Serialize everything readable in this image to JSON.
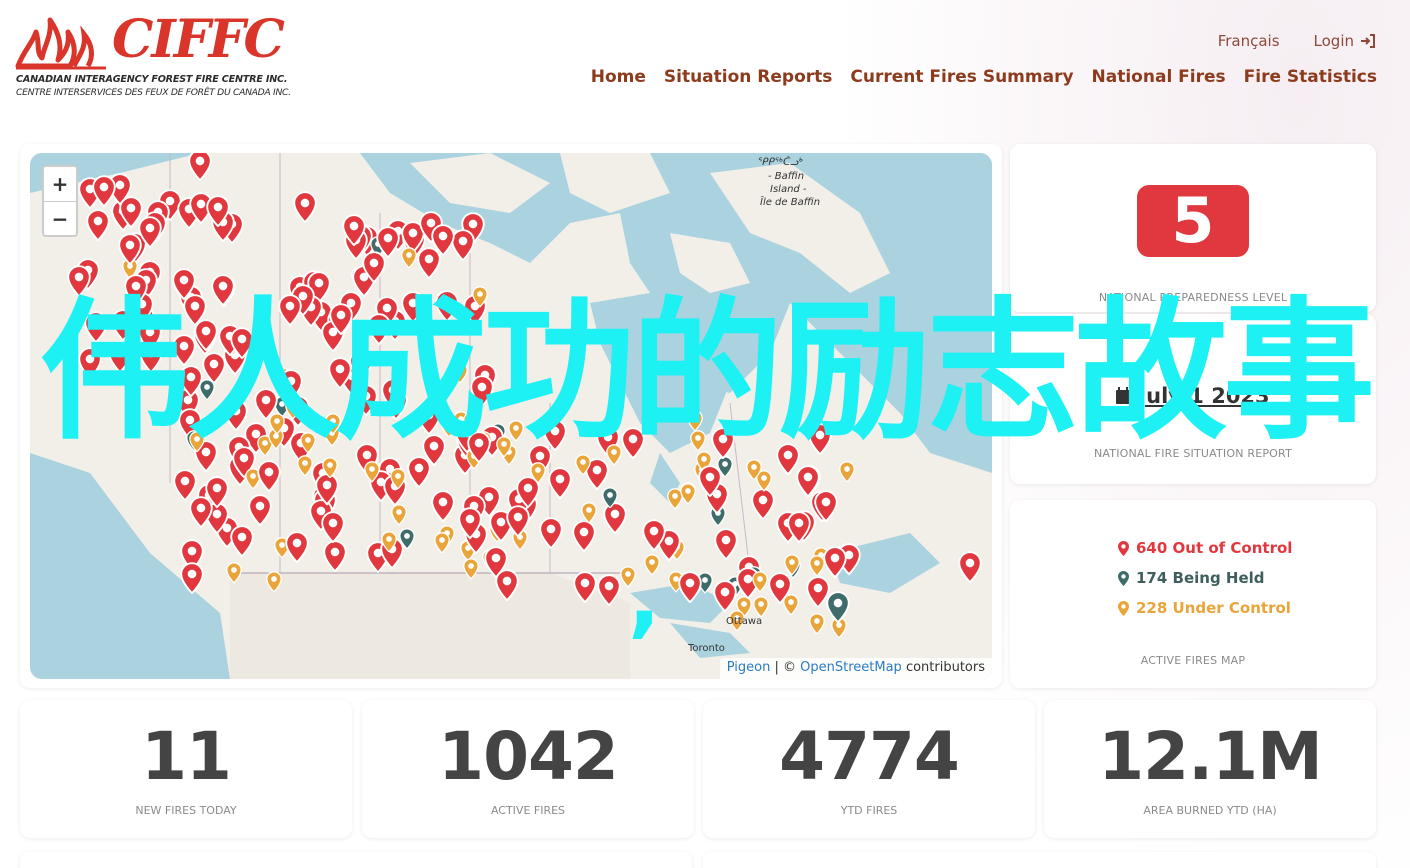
{
  "header": {
    "logo_word": "CIFFC",
    "logo_line_en": "CANADIAN INTERAGENCY FOREST FIRE CENTRE INC.",
    "logo_line_fr": "CENTRE INTERSERVICES DES FEUX DE FORÊT DU CANADA INC.",
    "lang_link": "Français",
    "login_link": "Login",
    "nav": [
      "Home",
      "Situation Reports",
      "Current Fires Summary",
      "National Fires",
      "Fire Statistics"
    ]
  },
  "map": {
    "zoom_in": "+",
    "zoom_out": "−",
    "attribution_pigeon": "Pigeon",
    "attribution_sep": " | © ",
    "attribution_osm": "OpenStreetMap",
    "attribution_tail": " contributors",
    "label_baffin_1": "ᕿᑭᖅᑖᓗᒃ",
    "label_baffin_2": "- Baffin",
    "label_baffin_3": "Island -",
    "label_baffin_4": "Île de Baffin",
    "label_ottawa": "Ottawa",
    "label_toronto": "Toronto",
    "colors": {
      "out_of_control": "#e0383e",
      "being_held": "#3f6b6a",
      "under_control": "#eaa53a"
    }
  },
  "preparedness": {
    "level": "5",
    "caption": "NATIONAL PREPAREDNESS LEVEL",
    "color": "#e0383e"
  },
  "report": {
    "date_visible": "July 1  2023",
    "caption": "NATIONAL FIRE SITUATION REPORT"
  },
  "legend": {
    "out_of_control": "640 Out of Control",
    "being_held": "174 Being Held",
    "under_control": "228 Under Control",
    "caption": "ACTIVE FIRES MAP"
  },
  "stats": [
    {
      "value": "11",
      "label": "NEW FIRES TODAY"
    },
    {
      "value": "1042",
      "label": "ACTIVE FIRES"
    },
    {
      "value": "4774",
      "label": "YTD FIRES"
    },
    {
      "value": "12.1M",
      "label": "AREA BURNED YTD (HA)"
    }
  ],
  "overlay": {
    "text": "伟人成功的励志故事",
    "comma": ","
  }
}
